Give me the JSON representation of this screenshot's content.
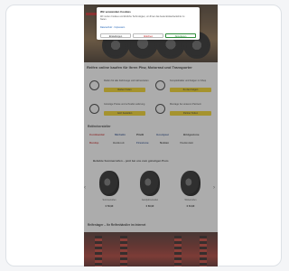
{
  "header": {
    "title": "Reifen Online"
  },
  "consent": {
    "title": "Wir verwenden Cookies",
    "text": "Wir nutzen Cookies und ähnliche Technologien, um Ihnen das beste Einkaufserlebnis zu bieten.",
    "link": "Datenschutz  ·  Impressum",
    "buttons": [
      "Einstellungen",
      "Ablehnen",
      "Akzeptieren"
    ]
  },
  "main": {
    "headline": "Reifen online kaufen für Ihren Pkw, Motorrad und Transporter",
    "features": [
      {
        "text": "Reifen für alle Fahrzeuge und Jahreszeiten",
        "button": "Reifen finden"
      },
      {
        "text": "Kompletträder und Felgen im Shop",
        "button": "Zu den Felgen"
      },
      {
        "text": "Günstige Preise und schnelle Lieferung",
        "button": "Jetzt bestellen"
      },
      {
        "text": "Montage bei unseren Partnern",
        "button": "Partner finden"
      }
    ],
    "brands_title": "Reifenhersteller",
    "brands": [
      "Continental",
      "Michelin",
      "Pirelli",
      "Goodyear",
      "Bridgestone",
      "Dunlop",
      "Hankook",
      "Firestone",
      "Nokian",
      "Vredestein"
    ],
    "products_title": "Beliebte Sommerreifen – jetzt bei uns zum günstigen Preis",
    "products": [
      {
        "name": "Sommerreifen",
        "price": "€ 59,90"
      },
      {
        "name": "Ganzjahresreifen",
        "price": "€ 69,90"
      },
      {
        "name": "Winterreifen",
        "price": "€ 64,90"
      }
    ],
    "warehouse_title": "Reifenlager – Ihr Reifenhändler im Internet"
  },
  "icons": {
    "tyre": "tire-icon",
    "rim": "rim-icon",
    "truck": "truck-icon",
    "wrench": "wrench-icon",
    "prev": "chevron-left-icon",
    "next": "chevron-right-icon"
  },
  "colors": {
    "accent": "#f2d21a",
    "brand": "#c42222"
  }
}
